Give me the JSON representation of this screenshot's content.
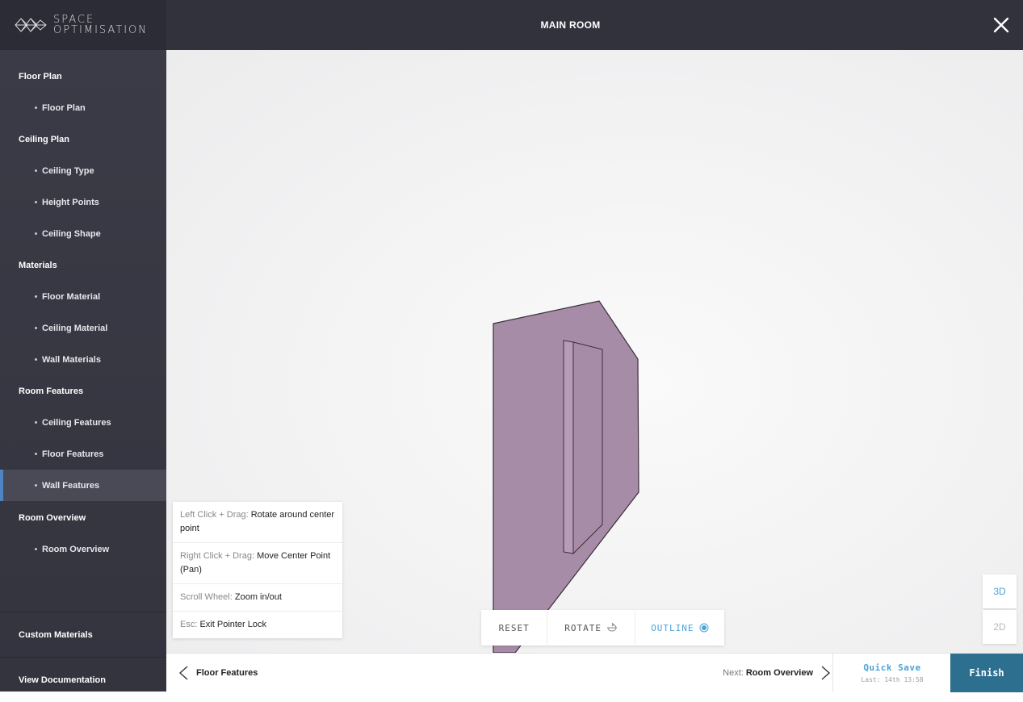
{
  "app": {
    "logo_line1": "SPACE",
    "logo_line2": "OPTIMISATION"
  },
  "header": {
    "title": "MAIN ROOM",
    "close_icon": "close-icon"
  },
  "sidebar": {
    "items": [
      {
        "label": "Floor Plan",
        "kind": "section"
      },
      {
        "label": "Floor Plan",
        "kind": "sub"
      },
      {
        "label": "Ceiling Plan",
        "kind": "section"
      },
      {
        "label": "Ceiling Type",
        "kind": "sub"
      },
      {
        "label": "Height Points",
        "kind": "sub"
      },
      {
        "label": "Ceiling Shape",
        "kind": "sub"
      },
      {
        "label": "Materials",
        "kind": "section"
      },
      {
        "label": "Floor Material",
        "kind": "sub"
      },
      {
        "label": "Ceiling Material",
        "kind": "sub"
      },
      {
        "label": "Wall Materials",
        "kind": "sub"
      },
      {
        "label": "Room Features",
        "kind": "section"
      },
      {
        "label": "Ceiling Features",
        "kind": "sub"
      },
      {
        "label": "Floor Features",
        "kind": "sub"
      },
      {
        "label": "Wall Features",
        "kind": "sub",
        "active": true
      },
      {
        "label": "Room Overview",
        "kind": "section"
      },
      {
        "label": "Room Overview",
        "kind": "sub"
      }
    ],
    "footer": {
      "custom_materials": "Custom Materials",
      "view_documentation": "View Documentation"
    }
  },
  "help": {
    "rows": [
      {
        "key": "Left Click + Drag:",
        "value": "Rotate around center point"
      },
      {
        "key": "Right Click + Drag:",
        "value": "Move Center Point (Pan)"
      },
      {
        "key": "Scroll Wheel:",
        "value": "Zoom in/out"
      },
      {
        "key": "Esc:",
        "value": "Exit Pointer Lock"
      }
    ]
  },
  "toolbar": {
    "reset": "RESET",
    "rotate": "ROTATE",
    "rotate_icon": "rotate-icon",
    "outline": "OUTLINE",
    "outline_icon": "radio-selected-icon",
    "outline_active": true
  },
  "view": {
    "btn_3d": "3D",
    "btn_2d": "2D",
    "active": "3D"
  },
  "footer": {
    "prev_label": "Floor Features",
    "next_key": "Next:",
    "next_label": "Room Overview",
    "quick_save": "Quick Save",
    "last_saved": "Last: 14th 13:58",
    "finish": "Finish"
  },
  "colors": {
    "wall_fill": "#a78ca7",
    "accent_blue": "#4aa3d8",
    "finish_bg": "#2d6f8f",
    "sidebar_bg": "#3b3b47",
    "active_indicator": "#4f84c4"
  }
}
